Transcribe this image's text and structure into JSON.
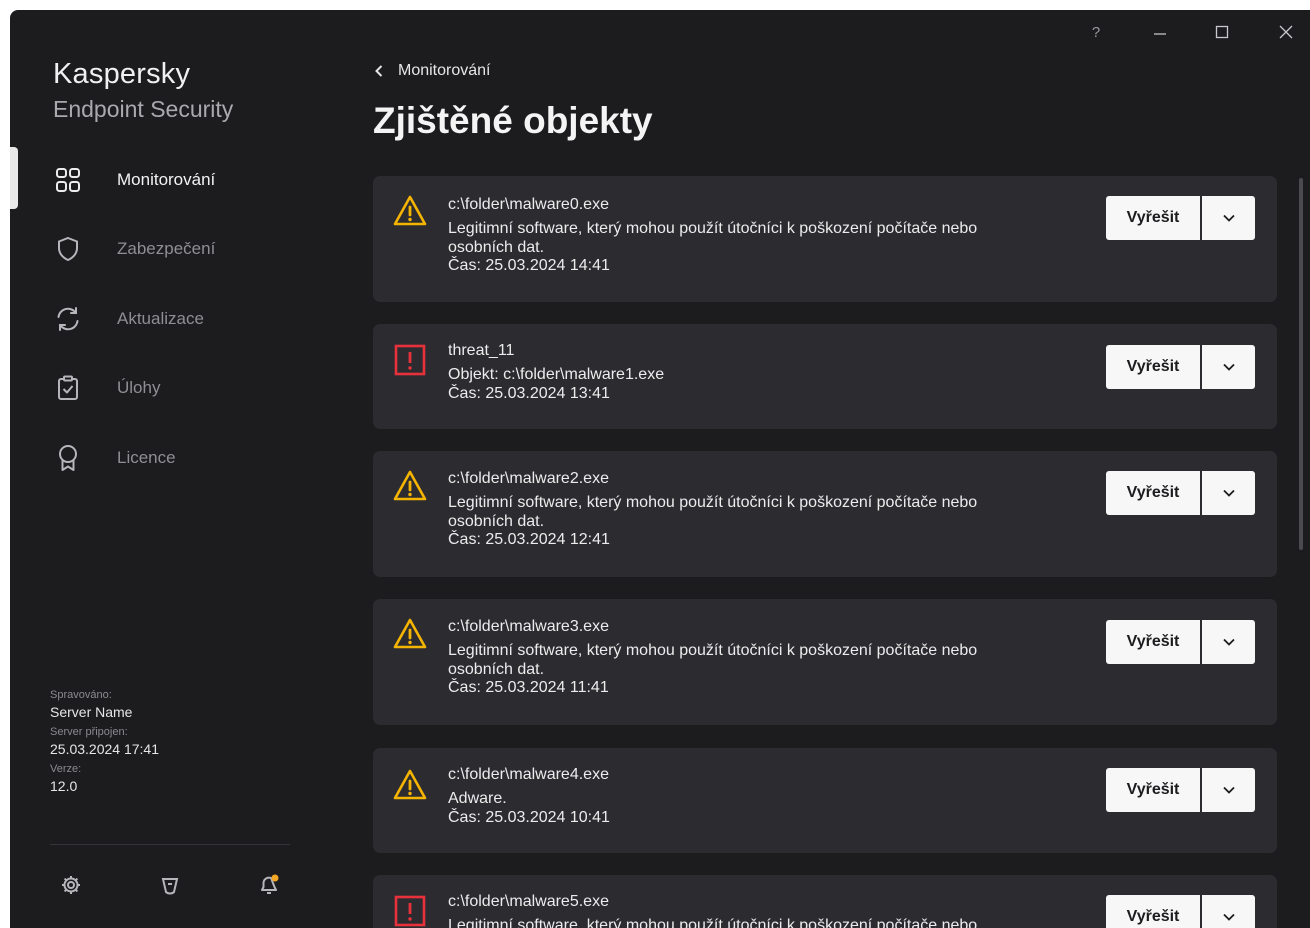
{
  "app": {
    "brand": "Kaspersky",
    "product": "Endpoint Security"
  },
  "window_controls": {
    "help": "?"
  },
  "sidebar": {
    "items": [
      {
        "label": "Monitorování",
        "icon": "dashboard-icon",
        "active": true
      },
      {
        "label": "Zabezpečení",
        "icon": "shield-icon",
        "active": false
      },
      {
        "label": "Aktualizace",
        "icon": "refresh-icon",
        "active": false
      },
      {
        "label": "Úlohy",
        "icon": "clipboard-check-icon",
        "active": false
      },
      {
        "label": "Licence",
        "icon": "award-icon",
        "active": false
      }
    ],
    "managed_label": "Spravováno:",
    "managed_value": "Server Name",
    "connected_label": "Server připojen:",
    "connected_value": "25.03.2024 17:41",
    "version_label": "Verze:",
    "version_value": "12.0",
    "bottom_icons": [
      "settings-icon",
      "support-icon",
      "notifications-icon"
    ]
  },
  "main": {
    "back_label": "Monitorování",
    "title": "Zjištěné objekty",
    "resolve_label": "Vyřešit",
    "cards": [
      {
        "severity": "warning",
        "lines": [
          "c:\\folder\\malware0.exe",
          "Legitimní software, který mohou použít útočníci k poškození počítače nebo",
          "osobních dat.",
          "Čas: 25.03.2024 14:41"
        ]
      },
      {
        "severity": "critical",
        "lines": [
          "threat_11",
          "Objekt: c:\\folder\\malware1.exe",
          "Čas: 25.03.2024 13:41"
        ]
      },
      {
        "severity": "warning",
        "lines": [
          "c:\\folder\\malware2.exe",
          "Legitimní software, který mohou použít útočníci k poškození počítače nebo",
          "osobních dat.",
          "Čas: 25.03.2024 12:41"
        ]
      },
      {
        "severity": "warning",
        "lines": [
          "c:\\folder\\malware3.exe",
          "Legitimní software, který mohou použít útočníci k poškození počítače nebo",
          "osobních dat.",
          "Čas: 25.03.2024 11:41"
        ]
      },
      {
        "severity": "warning",
        "lines": [
          "c:\\folder\\malware4.exe",
          "Adware.",
          "Čas: 25.03.2024 10:41"
        ]
      },
      {
        "severity": "critical",
        "lines": [
          "c:\\folder\\malware5.exe",
          "Legitimní software, který mohou použít útočníci k poškození počítače nebo"
        ]
      }
    ]
  },
  "colors": {
    "warning": "#f5b400",
    "critical": "#e8313b",
    "notification_dot": "#f5a623"
  }
}
